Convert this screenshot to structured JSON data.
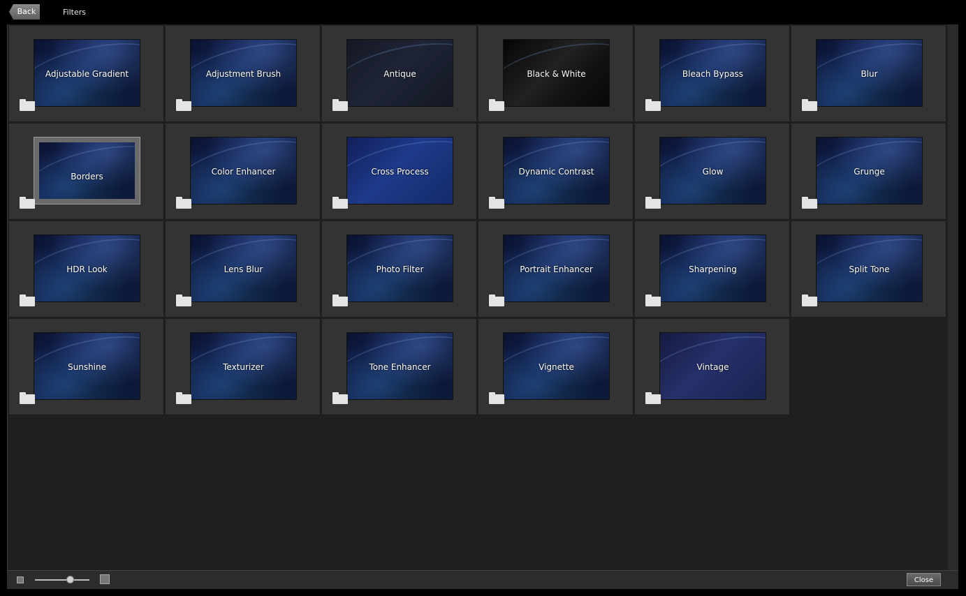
{
  "topbar": {
    "back_label": "Back",
    "title": "Filters"
  },
  "filters": [
    {
      "label": "Adjustable Gradient",
      "style": "default"
    },
    {
      "label": "Adjustment Brush",
      "style": "default"
    },
    {
      "label": "Antique",
      "style": "antique"
    },
    {
      "label": "Black & White",
      "style": "bw"
    },
    {
      "label": "Bleach Bypass",
      "style": "default"
    },
    {
      "label": "Blur",
      "style": "default"
    },
    {
      "label": "Borders",
      "style": "borders"
    },
    {
      "label": "Color Enhancer",
      "style": "default"
    },
    {
      "label": "Cross Process",
      "style": "cross"
    },
    {
      "label": "Dynamic Contrast",
      "style": "default"
    },
    {
      "label": "Glow",
      "style": "default"
    },
    {
      "label": "Grunge",
      "style": "default"
    },
    {
      "label": "HDR Look",
      "style": "default"
    },
    {
      "label": "Lens Blur",
      "style": "default"
    },
    {
      "label": "Photo Filter",
      "style": "default"
    },
    {
      "label": "Portrait Enhancer",
      "style": "default"
    },
    {
      "label": "Sharpening",
      "style": "default"
    },
    {
      "label": "Split Tone",
      "style": "default"
    },
    {
      "label": "Sunshine",
      "style": "default"
    },
    {
      "label": "Texturizer",
      "style": "default"
    },
    {
      "label": "Tone Enhancer",
      "style": "default"
    },
    {
      "label": "Vignette",
      "style": "default"
    },
    {
      "label": "Vintage",
      "style": "vintage"
    }
  ],
  "bottombar": {
    "zoom_level": 0.65,
    "close_label": "Close"
  }
}
